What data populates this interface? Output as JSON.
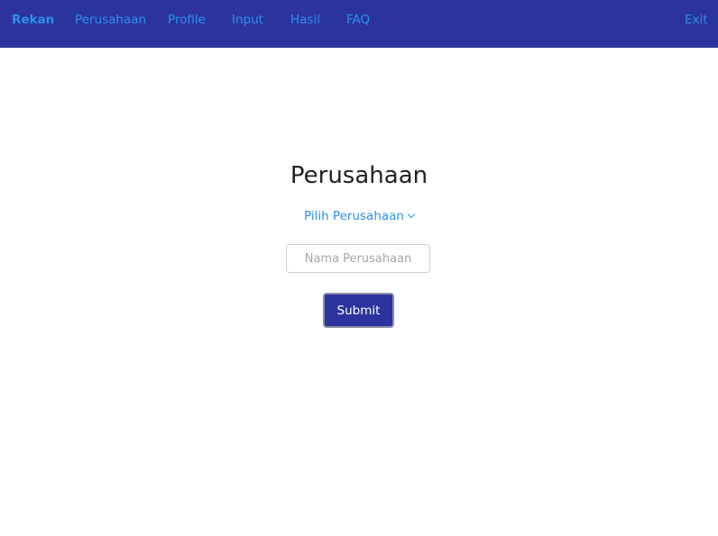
{
  "navbar": {
    "brand": "Rekan",
    "links": [
      "Perusahaan",
      "Profile",
      "Input",
      "Hasil",
      "FAQ"
    ],
    "exit": "Exit"
  },
  "main": {
    "title": "Perusahaan",
    "dropdown_label": "Pilih Perusahaan",
    "input_placeholder": "Nama Perusahaan",
    "input_value": "",
    "submit_label": "Submit"
  },
  "colors": {
    "navbar_bg": "#2b349c",
    "link": "#2f8ff0",
    "button_bg": "#2b349c",
    "title_text": "#222222"
  }
}
